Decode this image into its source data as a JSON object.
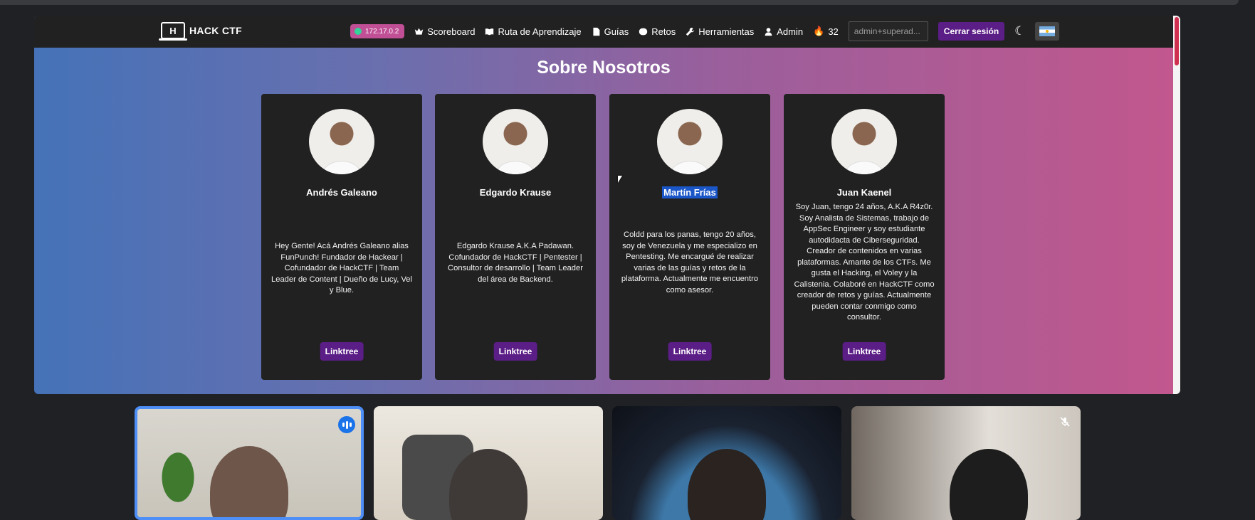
{
  "site": {
    "brand_letter": "H",
    "brand_name": "HACK CTF",
    "ip": "172.17.0.2",
    "nav": [
      {
        "label": "Scoreboard",
        "icon": "crown-icon"
      },
      {
        "label": "Ruta de Aprendizaje",
        "icon": "book-icon"
      },
      {
        "label": "Guías",
        "icon": "document-icon"
      },
      {
        "label": "Retos",
        "icon": "brain-icon"
      },
      {
        "label": "Herramientas",
        "icon": "wrench-icon"
      },
      {
        "label": "Admin",
        "icon": "user-icon"
      }
    ],
    "points": "32",
    "user_field": "admin+superad...",
    "logout": "Cerrar sesión",
    "theme_icon": "moon-icon",
    "flag_icon": "argentina-flag-icon",
    "accent": "#5b1d86",
    "ip_badge_color": "#c04f95"
  },
  "page": {
    "title": "Sobre Nosotros",
    "members": [
      {
        "name": "Andrés Galeano",
        "bio": "Hey Gente! Acá Andrés Galeano alias FunPunch! Fundador de Hackear | Cofundador de HackCTF | Team Leader de Content | Dueño de Lucy, Vel y Blue.",
        "button": "Linktree"
      },
      {
        "name": "Edgardo Krause",
        "bio": "Edgardo Krause A.K.A Padawan. Cofundador de HackCTF | Pentester | Consultor de desarrollo | Team Leader del área de Backend.",
        "button": "Linktree"
      },
      {
        "name": "Martín Frías",
        "bio": "Coldd para los panas, tengo 20 años, soy de Venezuela y me especializo en Pentesting. Me encargué de realizar varias de las guías y retos de la plataforma. Actualmente me encuentro como asesor.",
        "button": "Linktree"
      },
      {
        "name": "Juan Kaenel",
        "bio": "Soy Juan, tengo 24 años, A.K.A R4z0r. Soy Analista de Sistemas, trabajo de AppSec Engineer y soy estudiante autodidacta de Ciberseguridad. Creador de contenidos en varias plataformas. Amante de los CTFs. Me gusta el Hacking, el Voley y la Calistenia. Colaboré en HackCTF como creador de retos y guías. Actualmente pueden contar conmigo como consultor.",
        "button": "Linktree"
      }
    ]
  },
  "meeting": {
    "tiles": [
      {
        "id": "participant-1",
        "state": "speaking"
      },
      {
        "id": "participant-2",
        "state": "normal"
      },
      {
        "id": "participant-3",
        "state": "normal"
      },
      {
        "id": "participant-4",
        "state": "muted"
      }
    ]
  }
}
